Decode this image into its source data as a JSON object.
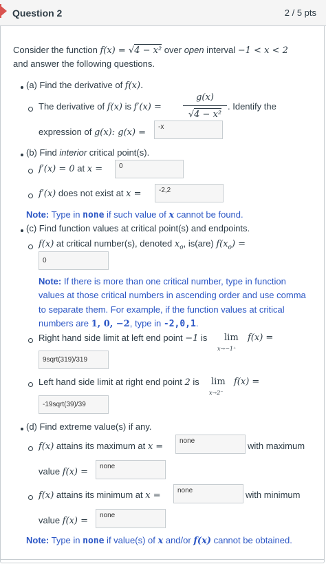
{
  "header": {
    "title": "Question 2",
    "points": "2 / 5 pts"
  },
  "intro": {
    "pre": "Consider the function ",
    "func": "f(x) = √4 − x²",
    "mid": " over ",
    "open": "open",
    "interval_word": " interval ",
    "interval": "−1 < x < 2",
    "line2": "and answer the following questions."
  },
  "part_a": {
    "heading": "(a) Find the derivative of ",
    "heading_math": "f(x).",
    "deriv_pre": "The derivative of ",
    "deriv_fx": "f(x)",
    "deriv_is": " is ",
    "deriv_fpx": "f′(x) =",
    "num": "g(x)",
    "den": "4 − x²",
    "identify": ". Identify the",
    "expr_pre": "expression of ",
    "expr_math": "g(x): g(x) =",
    "answer": "-x"
  },
  "part_b": {
    "heading_a": "(b) Find ",
    "heading_b": "interior",
    "heading_c": " critical point(s).",
    "item1_math": "f′(x) = 0",
    "item1_text": " at ",
    "item1_x": "x =",
    "item1_answer": "0",
    "item2_math": "f′(x)",
    "item2_text": " does not exist at ",
    "item2_x": "x =",
    "item2_answer": "-2,2",
    "note_label": "Note:",
    "note_a": " Type in ",
    "note_none": "none",
    "note_b": " if such value of ",
    "note_x": "x",
    "note_c": " cannot be found."
  },
  "part_c": {
    "heading": "(c) Find function values at critical point(s) and endpoints.",
    "item1_math": "f(x)",
    "item1_text": " at critical number(s), denoted ",
    "item1_xo": "x",
    "item1_sub": "o",
    "item1_text2": ", is(are) ",
    "item1_eq": "f(x",
    "item1_eq2": ") =",
    "item1_answer": "0",
    "note_label": "Note:",
    "note_l1": " If there is more than one critical number, type in function",
    "note_l2": "values at those critical numbers in ascending order and use comma",
    "note_l3": "to separate them. For example, if the function values at critical",
    "note_l4a": "numbers are ",
    "note_l4b": "1, 0, −2",
    "note_l4c": ", type in ",
    "note_l4d": "-2,0,1",
    "note_l4e": ".",
    "item2_text": "Right hand side limit at left end point ",
    "item2_pt": "−1",
    "item2_is": " is ",
    "item2_lim": "lim",
    "item2_sub": "x→−1⁺",
    "item2_fx": "f(x) =",
    "item2_answer": "9sqrt(319)/319",
    "item3_text": "Left hand side limit at right end point ",
    "item3_pt": "2",
    "item3_is": " is ",
    "item3_lim": "lim",
    "item3_sub": "x→2⁻",
    "item3_fx": "f(x) =",
    "item3_answer": "-19sqrt(39)/39"
  },
  "part_d": {
    "heading": "(d) Find extreme value(s) if any.",
    "max_math": "f(x)",
    "max_text": " attains its maximum at ",
    "max_x": "x =",
    "max_answer": "none",
    "max_with": "with maximum",
    "max_value": "value ",
    "max_fx": "f(x) =",
    "max_value_answer": "none",
    "min_math": "f(x)",
    "min_text": " attains its minimum at ",
    "min_x": "x =",
    "min_answer": "none",
    "min_with": "with minimum",
    "min_value": "value ",
    "min_fx": "f(x) =",
    "min_value_answer": "none",
    "note_label": "Note:",
    "note_a": " Type in ",
    "note_none": "none",
    "note_b": " if value(s) of ",
    "note_x": "x",
    "note_c": " and/or ",
    "note_fx": "f(x)",
    "note_d": " cannot be obtained."
  }
}
